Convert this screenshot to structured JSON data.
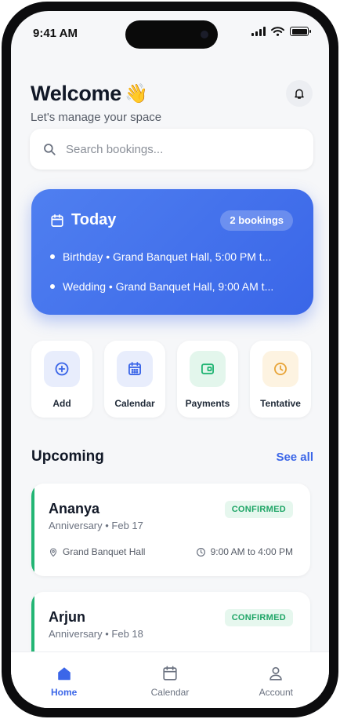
{
  "status_bar": {
    "time": "9:41 AM"
  },
  "header": {
    "title": "Welcome",
    "emoji": "👋",
    "subtitle": "Let's manage your space"
  },
  "search": {
    "placeholder": "Search bookings..."
  },
  "today": {
    "title": "Today",
    "badge": "2 bookings",
    "items": [
      "Birthday • Grand Banquet Hall, 5:00 PM t...",
      "Wedding • Grand Banquet Hall, 9:00 AM t..."
    ]
  },
  "quick_actions": [
    {
      "label": "Add",
      "icon": "plus-circle-icon",
      "bg": "#e8edfc",
      "color": "#3b66e8"
    },
    {
      "label": "Calendar",
      "icon": "calendar-icon",
      "bg": "#e8edfc",
      "color": "#3b66e8"
    },
    {
      "label": "Payments",
      "icon": "wallet-icon",
      "bg": "#e3f6ec",
      "color": "#23b574"
    },
    {
      "label": "Tentative",
      "icon": "clock-icon",
      "bg": "#fdf3e1",
      "color": "#e8a53a"
    }
  ],
  "upcoming": {
    "title": "Upcoming",
    "see_all": "See all",
    "bookings": [
      {
        "name": "Ananya",
        "meta": "Anniversary • Feb 17",
        "status": "CONFIRMED",
        "venue": "Grand Banquet Hall",
        "time": "9:00 AM to 4:00 PM"
      },
      {
        "name": "Arjun",
        "meta": "Anniversary • Feb 18",
        "status": "CONFIRMED"
      }
    ]
  },
  "tabbar": {
    "items": [
      {
        "label": "Home",
        "icon": "home-icon",
        "active": true
      },
      {
        "label": "Calendar",
        "icon": "calendar-icon",
        "active": false
      },
      {
        "label": "Account",
        "icon": "user-icon",
        "active": false
      }
    ]
  },
  "colors": {
    "accent": "#3b66e8",
    "confirmed": "#23b574",
    "background": "#f6f7f9"
  }
}
